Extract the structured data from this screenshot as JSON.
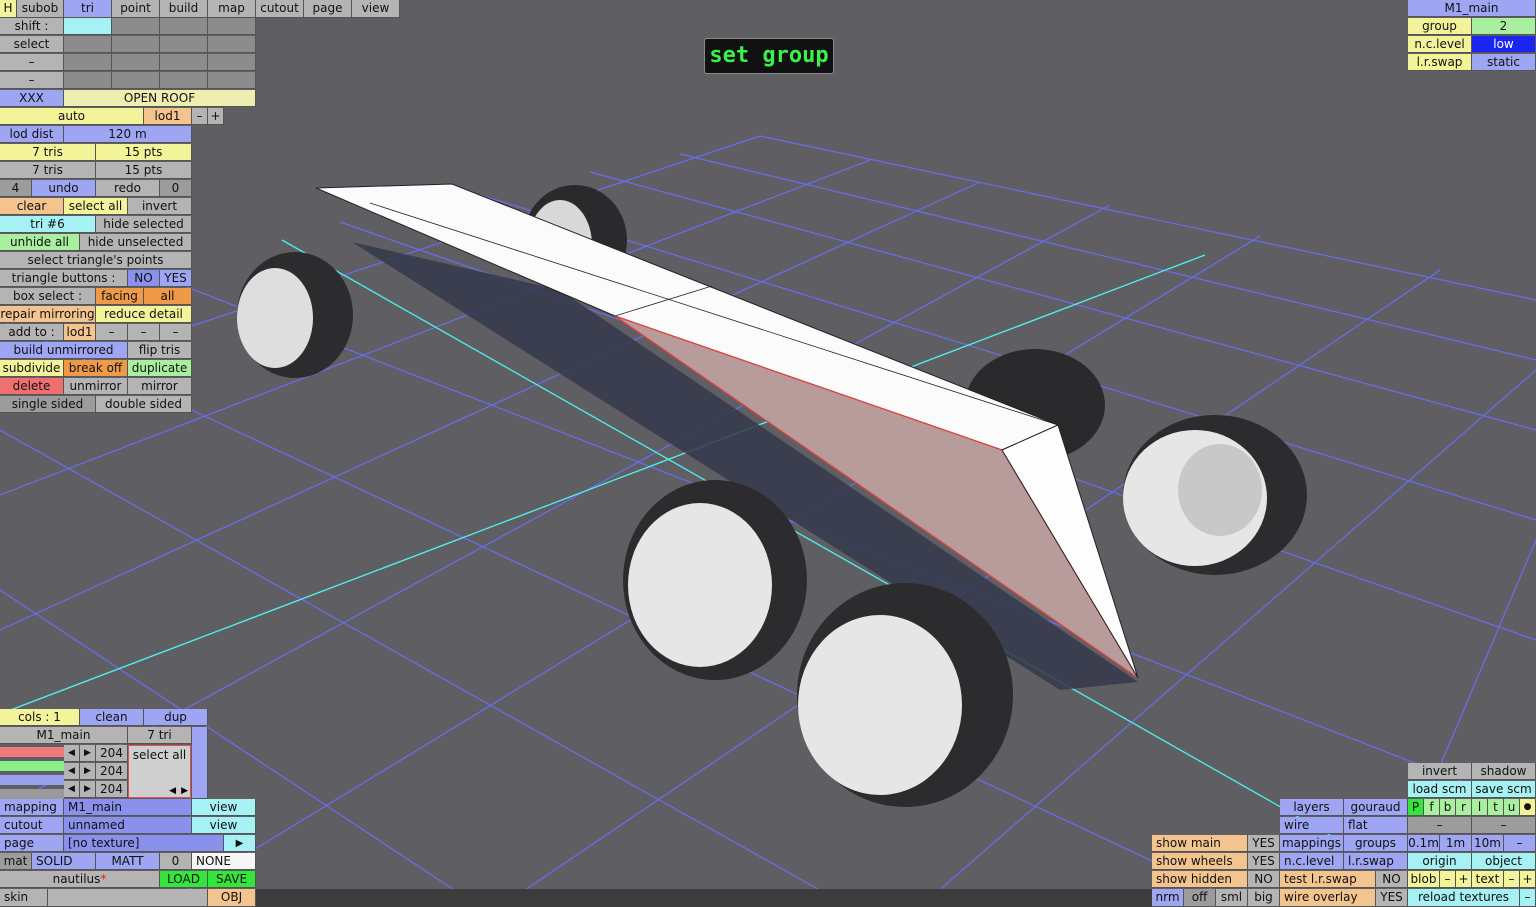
{
  "menu": {
    "h": "H",
    "items": [
      "subob",
      "tri",
      "point",
      "build",
      "map",
      "cutout",
      "page",
      "view"
    ]
  },
  "shift_label": "shift :",
  "select_label": "select",
  "dash": "–",
  "xxx": "XXX",
  "open_roof": "OPEN ROOF",
  "auto": "auto",
  "lod1": "lod1",
  "minus": "–",
  "plus": "+",
  "lod_dist": "lod dist",
  "lod_dist_value": "120 m",
  "tris_a": "7 tris",
  "pts_a": "15 pts",
  "tris_b": "7 tris",
  "pts_b": "15 pts",
  "undo_count": "4",
  "undo": "undo",
  "redo": "redo",
  "redo_count": "0",
  "clear": "clear",
  "select_all": "select all",
  "invert": "invert",
  "tri_id": "tri #6",
  "hide_selected": "hide selected",
  "unhide_all": "unhide all",
  "hide_unselected": "hide unselected",
  "select_triangle_points": "select triangle's points",
  "triangle_buttons": "triangle buttons :",
  "no": "NO",
  "yes": "YES",
  "box_select": "box select :",
  "facing": "facing",
  "all": "all",
  "repair_mirroring": "repair mirroring",
  "reduce_detail": "reduce detail",
  "add_to": "add to :",
  "build_unmirrored": "build unmirrored",
  "flip_tris": "flip tris",
  "subdivide": "subdivide",
  "break_off": "break off",
  "duplicate": "duplicate",
  "delete": "delete",
  "unmirror": "unmirror",
  "mirror": "mirror",
  "single_sided": "single sided",
  "double_sided": "double sided",
  "overlay_title": "set group",
  "top_right": {
    "title": "M1_main",
    "group_label": "group",
    "group_value": "2",
    "nc_level_label": "n.c.level",
    "nc_level_value": "low",
    "lr_swap_label": "l.r.swap",
    "lr_swap_value": "static"
  },
  "bottom_left": {
    "cols": "cols : 1",
    "clean": "clean",
    "dup": "dup",
    "mat_name": "M1_main",
    "tri_count": "7 tri",
    "rgb_values": [
      "204",
      "204",
      "204"
    ],
    "select_all": "select all",
    "mapping_label": "mapping",
    "mapping_value": "M1_main",
    "view": "view",
    "cutout_label": "cutout",
    "cutout_value": "unnamed",
    "page_label": "page",
    "page_value": "[no texture]",
    "mat": "mat",
    "solid": "SOLID",
    "matt": "MATT",
    "zero": "0",
    "none": "NONE",
    "skin_name": "nautilus",
    "asterisk": "*",
    "load": "LOAD",
    "save": "SAVE",
    "skin": "skin",
    "obj": "OBJ"
  },
  "bottom_right": {
    "show_main": "show main",
    "show_wheels": "show wheels",
    "show_hidden": "show hidden",
    "yes": "YES",
    "no": "NO",
    "nrm": "nrm",
    "off": "off",
    "sml": "sml",
    "big": "big",
    "layers": "layers",
    "gouraud": "gouraud",
    "wire": "wire",
    "flat": "flat",
    "mappings": "mappings",
    "groups": "groups",
    "nc_level": "n.c.level",
    "lr_swap": "l.r.swap",
    "test_lr_swap": "test l.r.swap",
    "wire_overlay": "wire overlay",
    "invert": "invert",
    "shadow": "shadow",
    "load_scm": "load scm",
    "save_scm": "save scm",
    "pfbrltu": [
      "P",
      "f",
      "b",
      "r",
      "l",
      "t",
      "u"
    ],
    "dot": "●",
    "dash": "–",
    "scale": [
      "0.1m",
      "1m",
      "10m"
    ],
    "origin": "origin",
    "object": "object",
    "blob": "blob",
    "text": "text",
    "reload_textures": "reload textures"
  }
}
